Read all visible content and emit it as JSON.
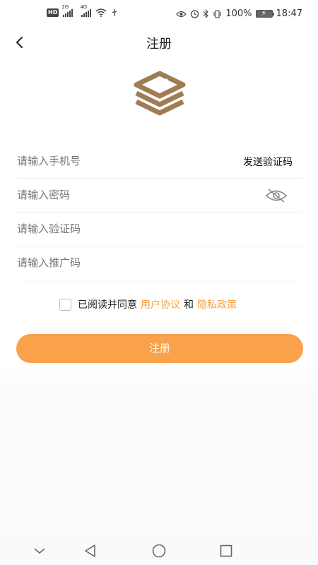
{
  "status_bar": {
    "net1": "2G",
    "net2": "4G",
    "battery": "100%",
    "time": "18:47"
  },
  "header": {
    "title": "注册"
  },
  "form": {
    "phone": {
      "placeholder": "请输入手机号",
      "value": ""
    },
    "send_code_label": "发送验证码",
    "password": {
      "placeholder": "请输入密码",
      "value": ""
    },
    "verify_code": {
      "placeholder": "请输入验证码",
      "value": ""
    },
    "promo_code": {
      "placeholder": "请输入推广码",
      "value": ""
    }
  },
  "agreement": {
    "prefix": "已阅读并同意",
    "user_agreement": "用户协议",
    "conjunction": "和",
    "privacy_policy": "隐私政策",
    "checked": false
  },
  "register_button_label": "注册",
  "colors": {
    "accent": "#f9a14b",
    "link": "#f3a345",
    "logo": "#a07c55"
  },
  "icons": {
    "back": "back-arrow-icon",
    "eye": "eye-hidden-icon",
    "nav_down": "chevron-down-icon",
    "nav_back": "triangle-back-icon",
    "nav_home": "circle-home-icon",
    "nav_recent": "square-recent-icon"
  }
}
